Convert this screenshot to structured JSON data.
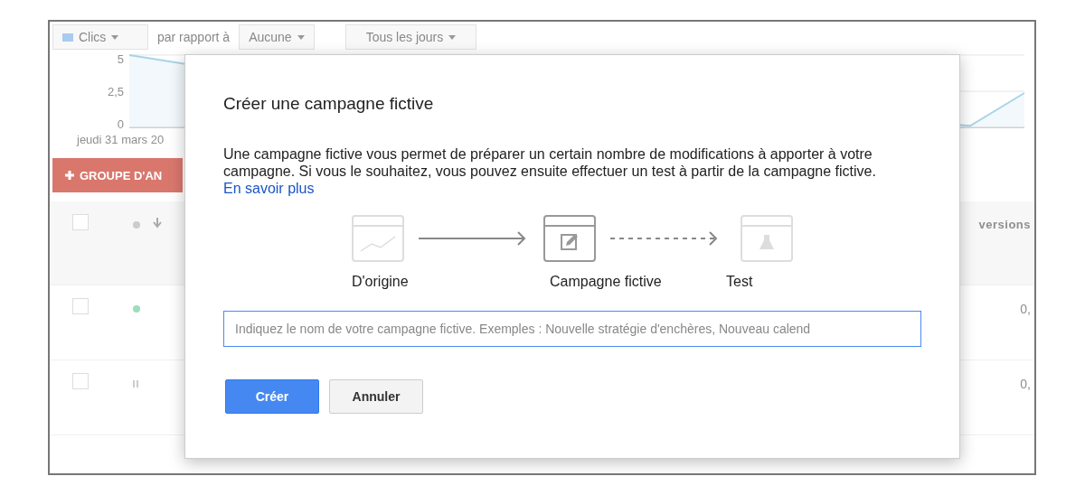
{
  "background": {
    "toolbar": {
      "metric": "Clics",
      "compare_label": "par rapport à",
      "compare": "Aucune",
      "period": "Tous les jours"
    },
    "chart": {
      "y_labels": [
        "5",
        "2,5",
        "0"
      ],
      "x_label": "jeudi 31 mars 20"
    },
    "add_button": "GROUPE D'AN",
    "table": {
      "header": {
        "checked": false,
        "last_column": "versions"
      },
      "rows": [
        {
          "checked": false,
          "kind": "active",
          "value": "0,"
        },
        {
          "checked": false,
          "kind": "paused",
          "value": "0,"
        }
      ]
    }
  },
  "dialog": {
    "title": "Créer une campagne fictive",
    "body": "Une campagne fictive vous permet de préparer un certain nombre de modifications à apporter à votre campagne. Si vous le souhaitez, vous pouvez ensuite effectuer un test à partir de la campagne fictive.",
    "link": "En savoir plus",
    "steps": [
      {
        "label": "D'origine",
        "active": false
      },
      {
        "label": "Campagne fictive",
        "active": true
      },
      {
        "label": "Test",
        "active": false
      }
    ],
    "connectors": [
      {
        "kind": "solid"
      },
      {
        "kind": "dashed"
      }
    ],
    "name_field": {
      "placeholder": "Indiquez le nom de votre campagne fictive. Exemples : Nouvelle stratégie d'enchères, Nouveau calend"
    },
    "buttons": [
      {
        "label": "Créer",
        "kind": "primary"
      },
      {
        "label": "Annuler",
        "kind": "secondary"
      }
    ]
  }
}
